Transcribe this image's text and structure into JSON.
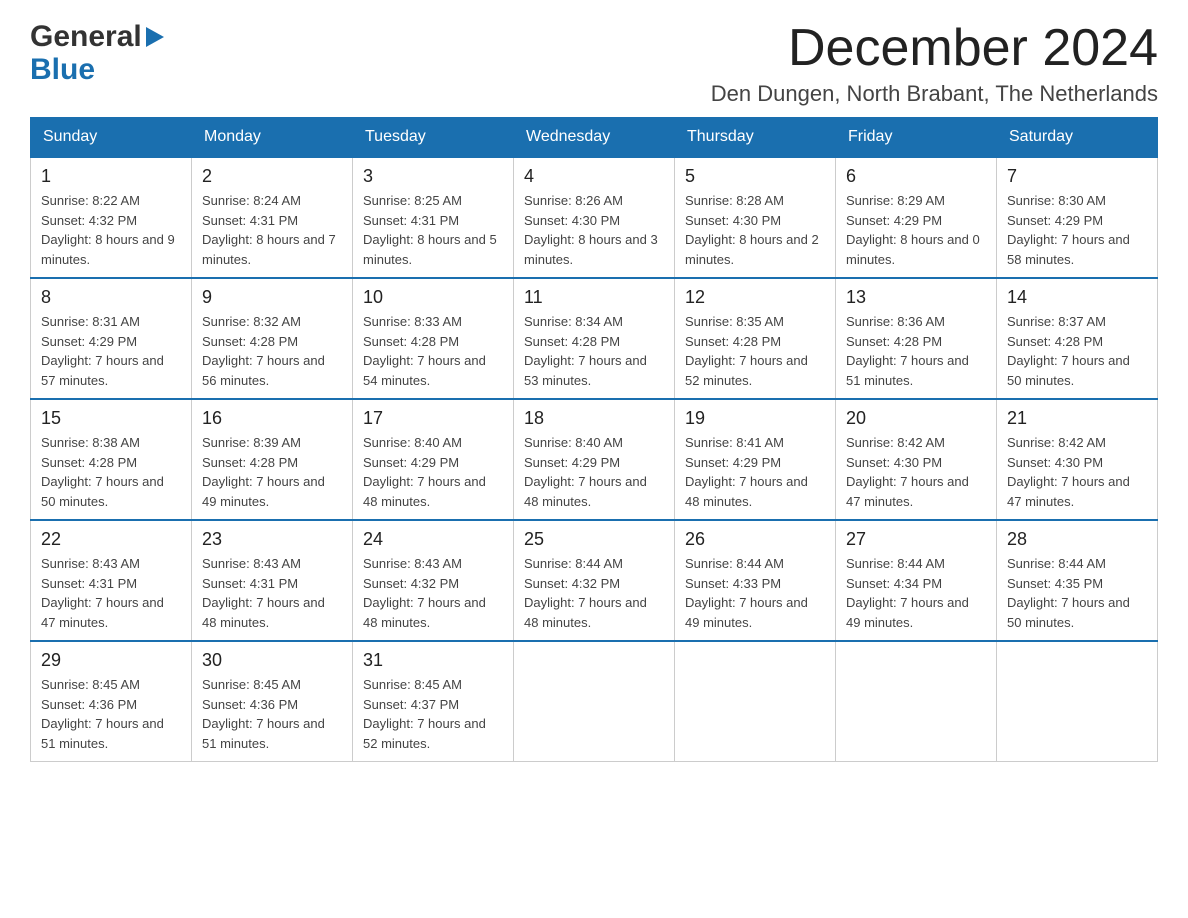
{
  "logo": {
    "general": "General",
    "blue": "Blue"
  },
  "header": {
    "title": "December 2024",
    "location": "Den Dungen, North Brabant, The Netherlands"
  },
  "days_of_week": [
    "Sunday",
    "Monday",
    "Tuesday",
    "Wednesday",
    "Thursday",
    "Friday",
    "Saturday"
  ],
  "weeks": [
    [
      {
        "day": "1",
        "sunrise": "Sunrise: 8:22 AM",
        "sunset": "Sunset: 4:32 PM",
        "daylight": "Daylight: 8 hours and 9 minutes."
      },
      {
        "day": "2",
        "sunrise": "Sunrise: 8:24 AM",
        "sunset": "Sunset: 4:31 PM",
        "daylight": "Daylight: 8 hours and 7 minutes."
      },
      {
        "day": "3",
        "sunrise": "Sunrise: 8:25 AM",
        "sunset": "Sunset: 4:31 PM",
        "daylight": "Daylight: 8 hours and 5 minutes."
      },
      {
        "day": "4",
        "sunrise": "Sunrise: 8:26 AM",
        "sunset": "Sunset: 4:30 PM",
        "daylight": "Daylight: 8 hours and 3 minutes."
      },
      {
        "day": "5",
        "sunrise": "Sunrise: 8:28 AM",
        "sunset": "Sunset: 4:30 PM",
        "daylight": "Daylight: 8 hours and 2 minutes."
      },
      {
        "day": "6",
        "sunrise": "Sunrise: 8:29 AM",
        "sunset": "Sunset: 4:29 PM",
        "daylight": "Daylight: 8 hours and 0 minutes."
      },
      {
        "day": "7",
        "sunrise": "Sunrise: 8:30 AM",
        "sunset": "Sunset: 4:29 PM",
        "daylight": "Daylight: 7 hours and 58 minutes."
      }
    ],
    [
      {
        "day": "8",
        "sunrise": "Sunrise: 8:31 AM",
        "sunset": "Sunset: 4:29 PM",
        "daylight": "Daylight: 7 hours and 57 minutes."
      },
      {
        "day": "9",
        "sunrise": "Sunrise: 8:32 AM",
        "sunset": "Sunset: 4:28 PM",
        "daylight": "Daylight: 7 hours and 56 minutes."
      },
      {
        "day": "10",
        "sunrise": "Sunrise: 8:33 AM",
        "sunset": "Sunset: 4:28 PM",
        "daylight": "Daylight: 7 hours and 54 minutes."
      },
      {
        "day": "11",
        "sunrise": "Sunrise: 8:34 AM",
        "sunset": "Sunset: 4:28 PM",
        "daylight": "Daylight: 7 hours and 53 minutes."
      },
      {
        "day": "12",
        "sunrise": "Sunrise: 8:35 AM",
        "sunset": "Sunset: 4:28 PM",
        "daylight": "Daylight: 7 hours and 52 minutes."
      },
      {
        "day": "13",
        "sunrise": "Sunrise: 8:36 AM",
        "sunset": "Sunset: 4:28 PM",
        "daylight": "Daylight: 7 hours and 51 minutes."
      },
      {
        "day": "14",
        "sunrise": "Sunrise: 8:37 AM",
        "sunset": "Sunset: 4:28 PM",
        "daylight": "Daylight: 7 hours and 50 minutes."
      }
    ],
    [
      {
        "day": "15",
        "sunrise": "Sunrise: 8:38 AM",
        "sunset": "Sunset: 4:28 PM",
        "daylight": "Daylight: 7 hours and 50 minutes."
      },
      {
        "day": "16",
        "sunrise": "Sunrise: 8:39 AM",
        "sunset": "Sunset: 4:28 PM",
        "daylight": "Daylight: 7 hours and 49 minutes."
      },
      {
        "day": "17",
        "sunrise": "Sunrise: 8:40 AM",
        "sunset": "Sunset: 4:29 PM",
        "daylight": "Daylight: 7 hours and 48 minutes."
      },
      {
        "day": "18",
        "sunrise": "Sunrise: 8:40 AM",
        "sunset": "Sunset: 4:29 PM",
        "daylight": "Daylight: 7 hours and 48 minutes."
      },
      {
        "day": "19",
        "sunrise": "Sunrise: 8:41 AM",
        "sunset": "Sunset: 4:29 PM",
        "daylight": "Daylight: 7 hours and 48 minutes."
      },
      {
        "day": "20",
        "sunrise": "Sunrise: 8:42 AM",
        "sunset": "Sunset: 4:30 PM",
        "daylight": "Daylight: 7 hours and 47 minutes."
      },
      {
        "day": "21",
        "sunrise": "Sunrise: 8:42 AM",
        "sunset": "Sunset: 4:30 PM",
        "daylight": "Daylight: 7 hours and 47 minutes."
      }
    ],
    [
      {
        "day": "22",
        "sunrise": "Sunrise: 8:43 AM",
        "sunset": "Sunset: 4:31 PM",
        "daylight": "Daylight: 7 hours and 47 minutes."
      },
      {
        "day": "23",
        "sunrise": "Sunrise: 8:43 AM",
        "sunset": "Sunset: 4:31 PM",
        "daylight": "Daylight: 7 hours and 48 minutes."
      },
      {
        "day": "24",
        "sunrise": "Sunrise: 8:43 AM",
        "sunset": "Sunset: 4:32 PM",
        "daylight": "Daylight: 7 hours and 48 minutes."
      },
      {
        "day": "25",
        "sunrise": "Sunrise: 8:44 AM",
        "sunset": "Sunset: 4:32 PM",
        "daylight": "Daylight: 7 hours and 48 minutes."
      },
      {
        "day": "26",
        "sunrise": "Sunrise: 8:44 AM",
        "sunset": "Sunset: 4:33 PM",
        "daylight": "Daylight: 7 hours and 49 minutes."
      },
      {
        "day": "27",
        "sunrise": "Sunrise: 8:44 AM",
        "sunset": "Sunset: 4:34 PM",
        "daylight": "Daylight: 7 hours and 49 minutes."
      },
      {
        "day": "28",
        "sunrise": "Sunrise: 8:44 AM",
        "sunset": "Sunset: 4:35 PM",
        "daylight": "Daylight: 7 hours and 50 minutes."
      }
    ],
    [
      {
        "day": "29",
        "sunrise": "Sunrise: 8:45 AM",
        "sunset": "Sunset: 4:36 PM",
        "daylight": "Daylight: 7 hours and 51 minutes."
      },
      {
        "day": "30",
        "sunrise": "Sunrise: 8:45 AM",
        "sunset": "Sunset: 4:36 PM",
        "daylight": "Daylight: 7 hours and 51 minutes."
      },
      {
        "day": "31",
        "sunrise": "Sunrise: 8:45 AM",
        "sunset": "Sunset: 4:37 PM",
        "daylight": "Daylight: 7 hours and 52 minutes."
      },
      null,
      null,
      null,
      null
    ]
  ]
}
